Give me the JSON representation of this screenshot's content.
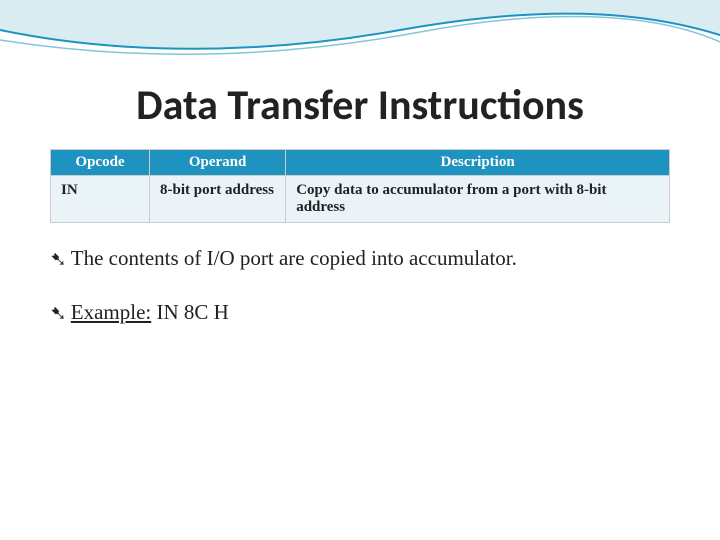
{
  "title": "Data Transfer Instructions",
  "table": {
    "headers": [
      "Opcode",
      "Operand",
      "Description"
    ],
    "row": {
      "opcode": "IN",
      "operand": "8-bit port address",
      "description": "Copy data to accumulator from a port with 8-bit address"
    }
  },
  "bullets": {
    "b1": "The contents of I/O port are copied into accumulator.",
    "b2_label": "Example:",
    "b2_value": " IN 8C H"
  }
}
